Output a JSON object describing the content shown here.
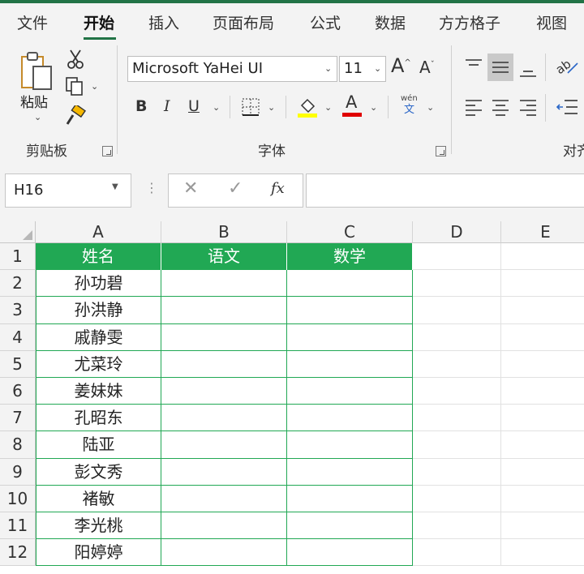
{
  "ribbon_tabs": [
    "文件",
    "开始",
    "插入",
    "页面布局",
    "公式",
    "数据",
    "方方格子",
    "视图"
  ],
  "active_tab": "开始",
  "accent_color": "#217346",
  "header_fill": "#21a854",
  "clipboard": {
    "paste_label": "粘贴",
    "group_label": "剪贴板"
  },
  "font": {
    "name": "Microsoft YaHei UI",
    "size": "11",
    "group_label": "字体",
    "bold": "B",
    "italic": "I",
    "underline": "U",
    "font_color_letter": "A",
    "phonetic_top": "wén",
    "phonetic_bottom": "文"
  },
  "alignment": {
    "group_label_partial": "对齐"
  },
  "formula_bar": {
    "name_box": "H16",
    "fx": "fx",
    "value": ""
  },
  "columns": [
    "A",
    "B",
    "C",
    "D",
    "E"
  ],
  "rows": [
    "1",
    "2",
    "3",
    "4",
    "5",
    "6",
    "7",
    "8",
    "9",
    "10",
    "11",
    "12"
  ],
  "table_headers": [
    "姓名",
    "语文",
    "数学"
  ],
  "names": [
    "孙功碧",
    "孙洪静",
    "戚静雯",
    "尤菜玲",
    "姜妹妹",
    "孔昭东",
    "陆亚",
    "彭文秀",
    "褚敏",
    "李光桃",
    "阳婷婷"
  ]
}
